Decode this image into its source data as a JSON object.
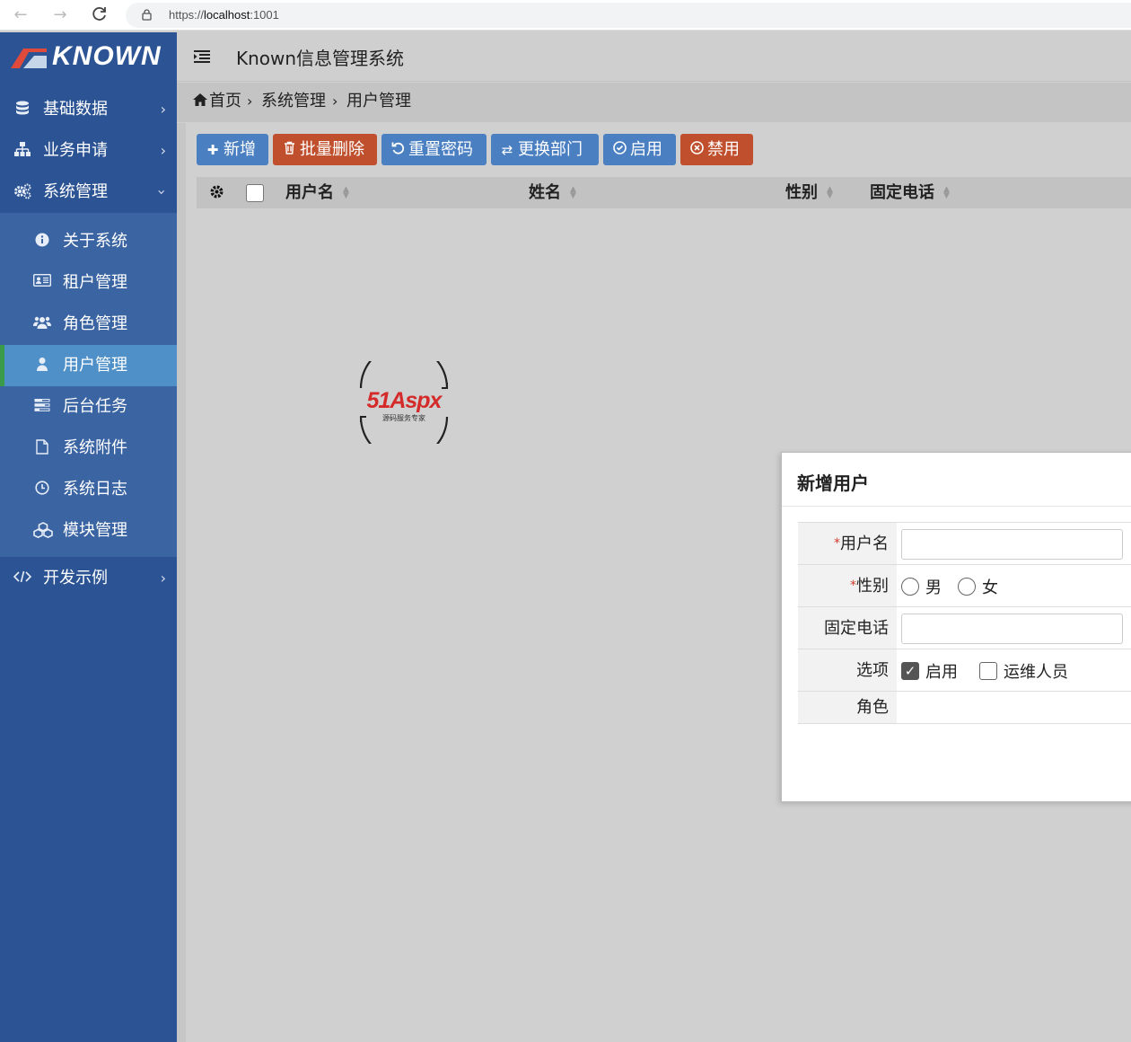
{
  "browser": {
    "url_prefix": "https://",
    "url_host": "localhost",
    "url_port": ":1001"
  },
  "logo": {
    "text": "KNOWN"
  },
  "header": {
    "title": "Known信息管理系统"
  },
  "breadcrumb": {
    "home": "首页",
    "level1": "系统管理",
    "level2": "用户管理"
  },
  "sidebar": {
    "items": [
      {
        "label": "基础数据",
        "icon": "database-icon"
      },
      {
        "label": "业务申请",
        "icon": "sitemap-icon"
      },
      {
        "label": "系统管理",
        "icon": "gears-icon"
      },
      {
        "label": "开发示例",
        "icon": "code-icon"
      }
    ],
    "sub_items": [
      {
        "label": "关于系统",
        "icon": "info-icon"
      },
      {
        "label": "租户管理",
        "icon": "id-card-icon"
      },
      {
        "label": "角色管理",
        "icon": "users-icon"
      },
      {
        "label": "用户管理",
        "icon": "user-icon"
      },
      {
        "label": "后台任务",
        "icon": "tasks-icon"
      },
      {
        "label": "系统附件",
        "icon": "file-icon"
      },
      {
        "label": "系统日志",
        "icon": "clock-icon"
      },
      {
        "label": "模块管理",
        "icon": "cubes-icon"
      }
    ]
  },
  "toolbar": {
    "add": "新增",
    "batch_delete": "批量删除",
    "reset_password": "重置密码",
    "change_dept": "更换部门",
    "enable": "启用",
    "disable": "禁用"
  },
  "table": {
    "columns": [
      "用户名",
      "姓名",
      "性别",
      "固定电话"
    ]
  },
  "watermark": {
    "brand": "51Aspx",
    "tagline": "源码服务专家"
  },
  "dialog": {
    "title": "新增用户",
    "fields": {
      "username_label": "用户名",
      "gender_label": "性别",
      "gender_male": "男",
      "gender_female": "女",
      "phone_label": "固定电话",
      "options_label": "选项",
      "option_enabled": "启用",
      "option_ops": "运维人员",
      "role_label": "角色"
    },
    "required_mark": "*"
  }
}
